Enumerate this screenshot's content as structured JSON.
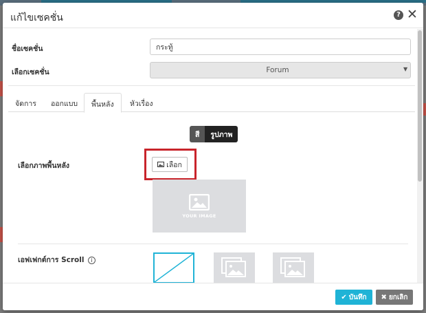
{
  "modal": {
    "title": "แก้ไขเซคชั่น",
    "help_icon": "question-circle-icon",
    "close_icon": "close-icon"
  },
  "form": {
    "section_name_label": "ชื่อเซคชั่น",
    "section_name_value": "กระทู้",
    "section_select_label": "เลือกเซคชั่น",
    "section_select_value": "Forum"
  },
  "tabs": [
    {
      "label": "จัดการ",
      "active": false
    },
    {
      "label": "ออกแบบ",
      "active": false
    },
    {
      "label": "พื้นหลัง",
      "active": true
    },
    {
      "label": "หัวเรื่อง",
      "active": false
    }
  ],
  "background": {
    "toggle": [
      {
        "label": "สี",
        "active": true
      },
      {
        "label": "รูปภาพ",
        "active": false
      }
    ],
    "image_label": "เลือกภาพพื้นหลัง",
    "choose_button_label": "เลือก",
    "choose_button_icon": "image-icon",
    "preview_caption": "YOUR IMAGE",
    "scroll_effect_label": "เอฟเฟกต์การ Scroll",
    "info_icon_glyph": "i"
  },
  "footer": {
    "save_label": "บันทึก",
    "cancel_label": "ยกเลิก"
  },
  "colors": {
    "accent": "#1fb3d6",
    "highlight": "#c8242b",
    "cancel": "#777777"
  }
}
